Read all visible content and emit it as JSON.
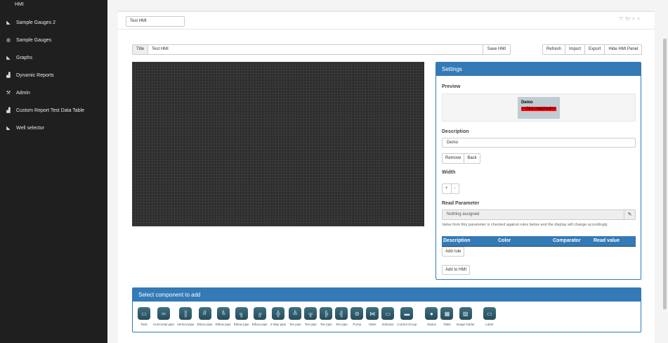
{
  "sidebar": {
    "top_label": "HMI",
    "items": [
      {
        "label": "Sample Gauges 2",
        "icon": "area-chart-icon"
      },
      {
        "label": "Sample Gauges",
        "icon": "dashboard-icon"
      },
      {
        "label": "Graphs",
        "icon": "area-chart-icon"
      },
      {
        "label": "Dynamic Reports",
        "icon": "bar-chart-icon"
      },
      {
        "label": "Admin",
        "icon": "wrench-icon"
      },
      {
        "label": "Custom Report Test Data Table",
        "icon": "bar-chart-icon"
      },
      {
        "label": "Well selector",
        "icon": "area-chart-icon"
      }
    ]
  },
  "header": {
    "name_value": "Test HMI",
    "tools": [
      "expand-icon",
      "wrench-icon",
      "collapse-icon",
      "close-icon"
    ]
  },
  "toolbar": {
    "title_label": "Title",
    "title_value": "Test HMI",
    "save_label": "Save HMI",
    "buttons": [
      "Refresh",
      "Import",
      "Export",
      "Hide HMI Panel"
    ]
  },
  "settings": {
    "title": "Settings",
    "preview_label": "Preview",
    "preview": {
      "name": "Demo",
      "value": "<<Not matched>>",
      "value_color": "#ff0000"
    },
    "description_label": "Description",
    "description_value": "Demo",
    "remove_label": "Remove",
    "back_label": "Back",
    "width_label": "Width",
    "plus": "+",
    "minus": "-",
    "read_param_label": "Read Parameter",
    "read_param_value": "Nothing assigned",
    "help_text": "Value from this parameter is checked against rules below and the display will change accordingly.",
    "rules_columns": [
      "Description",
      "Color",
      "Comparator",
      "Read value"
    ],
    "add_rule_label": "Add rule",
    "add_to_hmi_label": "Add to HMI"
  },
  "components": {
    "title": "Select component to add",
    "items": [
      {
        "label": "Tank",
        "glyph": "▭"
      },
      {
        "label": "Horizontal pipe",
        "glyph": "═"
      },
      {
        "label": "Vertical pipe",
        "glyph": "║"
      },
      {
        "label": "Elbow pipe",
        "glyph": "╝"
      },
      {
        "label": "Elbow pipe",
        "glyph": "╚"
      },
      {
        "label": "Elbow pipe",
        "glyph": "╗"
      },
      {
        "label": "Elbow pipe",
        "glyph": "╔"
      },
      {
        "label": "4-Way pipe",
        "glyph": "╬"
      },
      {
        "label": "Tee pipe",
        "glyph": "╩"
      },
      {
        "label": "Tee pipe",
        "glyph": "╦"
      },
      {
        "label": "Tee pipe",
        "glyph": "╠"
      },
      {
        "label": "Tee pipe",
        "glyph": "╣"
      },
      {
        "label": "Pump",
        "glyph": "⊘"
      },
      {
        "label": "Valve",
        "glyph": "⋈"
      },
      {
        "label": "Indicator",
        "glyph": "▭"
      },
      {
        "label": "Control Group",
        "glyph": "▬"
      },
      {
        "label": "Status",
        "glyph": "●"
      },
      {
        "label": "Table",
        "glyph": "▦"
      },
      {
        "label": "Image holder",
        "glyph": "▨"
      },
      {
        "label": "Label",
        "glyph": "▭"
      }
    ]
  },
  "colors": {
    "sidebar": "#1f1f1f",
    "accent": "#337ab7"
  }
}
